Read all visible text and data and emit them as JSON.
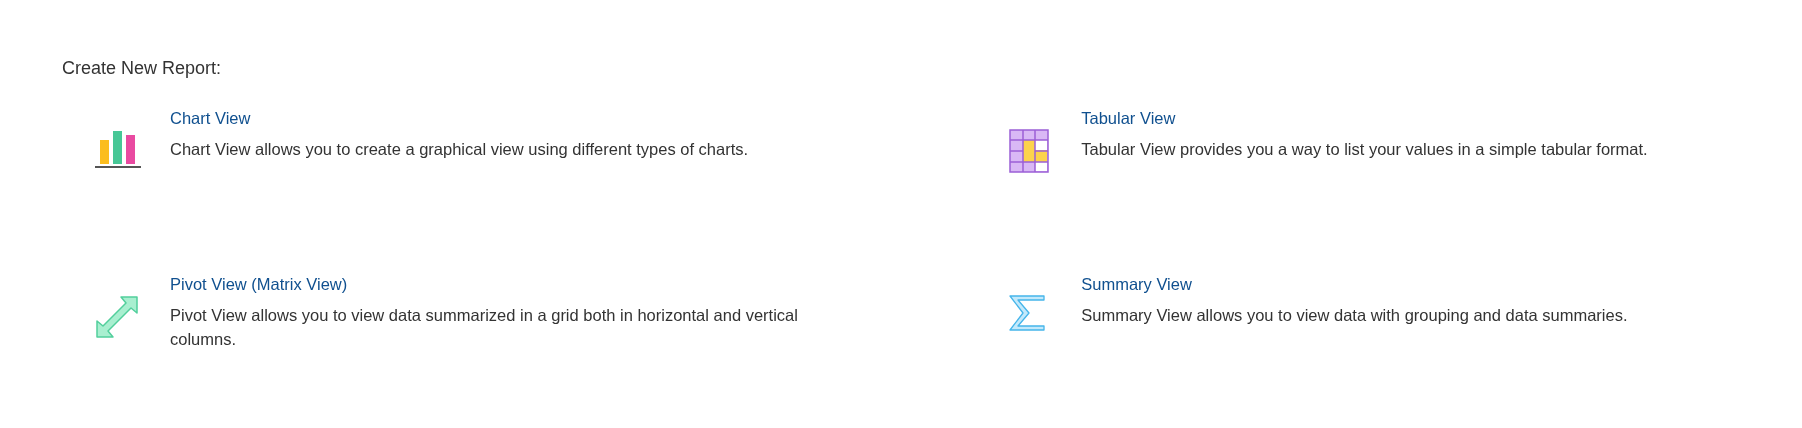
{
  "heading": "Create New Report:",
  "options": [
    {
      "kind": "chart",
      "title": "Chart View",
      "description": "Chart View allows you to create a graphical view using different types of charts."
    },
    {
      "kind": "table",
      "title": "Tabular View",
      "description": "Tabular View provides you a way to list your values in a simple tabular format."
    },
    {
      "kind": "pivot",
      "title": "Pivot View (Matrix View)",
      "description": "Pivot View allows you to view data summarized in a grid both in horizontal and vertical columns."
    },
    {
      "kind": "summary",
      "title": "Summary View",
      "description": "Summary View allows you to view data with grouping and data summaries."
    }
  ]
}
